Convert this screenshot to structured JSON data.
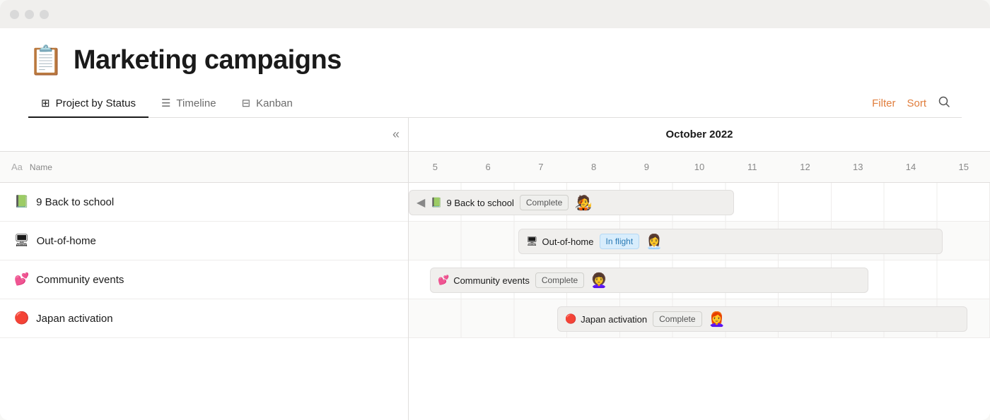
{
  "window": {
    "title": "Marketing campaigns"
  },
  "header": {
    "icon": "📋",
    "title": "Marketing campaigns",
    "tabs": [
      {
        "id": "project-by-status",
        "label": "Project by Status",
        "icon": "⊞",
        "active": true
      },
      {
        "id": "timeline",
        "label": "Timeline",
        "icon": "≡",
        "active": false
      },
      {
        "id": "kanban",
        "label": "Kanban",
        "icon": "⊟",
        "active": false
      }
    ],
    "filter_label": "Filter",
    "sort_label": "Sort"
  },
  "left_panel": {
    "collapse_icon": "«",
    "column_header": {
      "aa": "Aa",
      "name": "Name"
    },
    "rows": [
      {
        "emoji": "📗",
        "name": "9 Back to school"
      },
      {
        "emoji": "🖥",
        "name": "Out-of-home"
      },
      {
        "emoji": "💕",
        "name": "Community events"
      },
      {
        "emoji": "🔴",
        "name": "Japan activation"
      }
    ]
  },
  "timeline": {
    "month": "October 2022",
    "dates": [
      "5",
      "6",
      "7",
      "8",
      "9",
      "10",
      "11",
      "12",
      "13",
      "14",
      "15"
    ],
    "tasks": [
      {
        "emoji": "📗",
        "label": "9 Back to school",
        "status": "Complete",
        "status_type": "complete",
        "avatar_emoji": "🧑‍🎤",
        "row": 0,
        "has_back_arrow": true
      },
      {
        "emoji": "🖥",
        "label": "Out-of-home",
        "status": "In flight",
        "status_type": "inflight",
        "avatar_emoji": "👩‍💼",
        "row": 1,
        "has_back_arrow": false
      },
      {
        "emoji": "💕",
        "label": "Community events",
        "status": "Complete",
        "status_type": "complete",
        "avatar_emoji": "👩‍🦱",
        "row": 2,
        "has_back_arrow": false
      },
      {
        "emoji": "🔴",
        "label": "Japan activation",
        "status": "Complete",
        "status_type": "complete",
        "avatar_emoji": "👩‍🦰",
        "row": 3,
        "has_back_arrow": false
      }
    ]
  }
}
